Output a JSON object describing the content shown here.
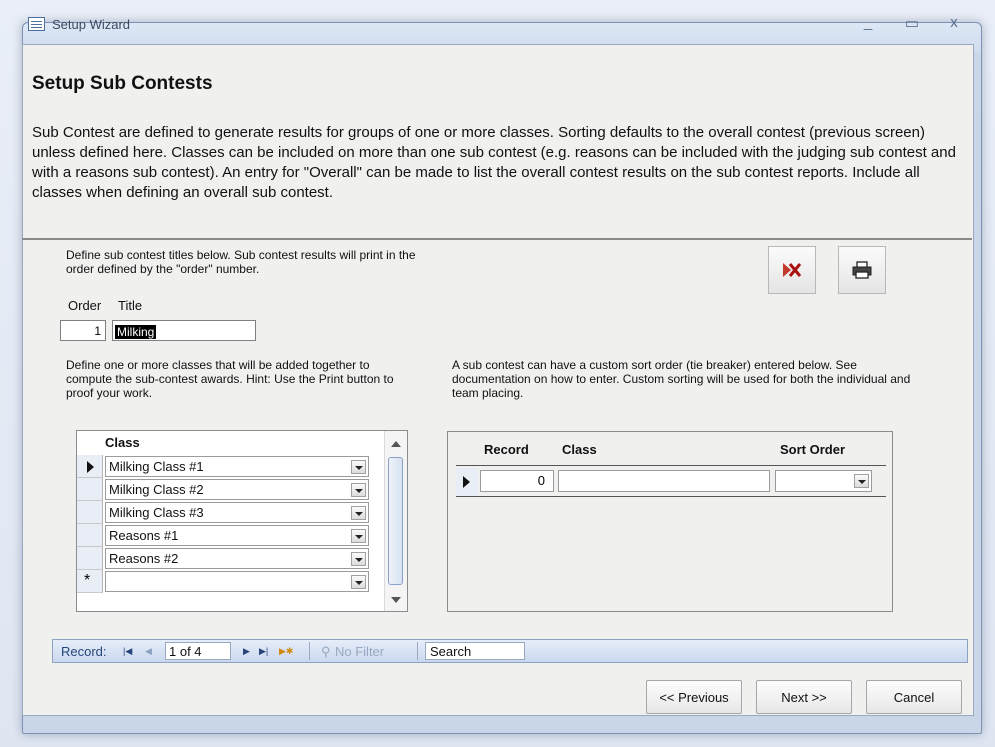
{
  "window": {
    "title": "Setup Wizard",
    "controls": {
      "minimize": "_",
      "maximize": "▭",
      "close": "x"
    }
  },
  "page": {
    "heading": "Setup Sub Contests",
    "intro": "Sub Contest are defined to generate results for groups of one or more classes.  Sorting defaults to the overall contest (previous screen) unless defined here.  Classes can be included on more than one sub contest (e.g. reasons can be included with the judging sub contest and with a reasons sub contest).  An entry for \"Overall\" can be made to list the overall contest results on the sub contest reports.  Include all classes when defining an overall sub contest."
  },
  "form": {
    "define_titles_text": "Define sub contest titles below.  Sub contest results will print in the order defined by the \"order\" number.",
    "order_label": "Order",
    "title_label": "Title",
    "order_value": "1",
    "title_value": "Milking",
    "delete_icon": "delete-record-icon",
    "print_icon": "print-icon",
    "define_classes_text": "Define one or more classes that will be added together to compute the sub-contest awards.  Hint: Use the Print button to proof your work.",
    "custom_sort_text": "A sub contest can have a custom sort order (tie breaker) entered below.  See documentation on how to enter. Custom sorting will be used for both the individual and team placing."
  },
  "classes_grid": {
    "header": "Class",
    "rows": [
      "Milking Class #1",
      "Milking Class #2",
      "Milking Class #3",
      "Reasons #1",
      "Reasons #2",
      ""
    ],
    "new_row_marker": "*"
  },
  "sort_grid": {
    "headers": {
      "record": "Record",
      "class": "Class",
      "sort_order": "Sort Order"
    },
    "row": {
      "record": "0",
      "class": "",
      "sort_order": ""
    }
  },
  "navigation": {
    "record_label": "Record:",
    "record_value": "1 of 4",
    "filter_label": "No Filter",
    "search_label": "Search"
  },
  "buttons": {
    "previous": "<< Previous",
    "next": "Next >>",
    "cancel": "Cancel"
  }
}
